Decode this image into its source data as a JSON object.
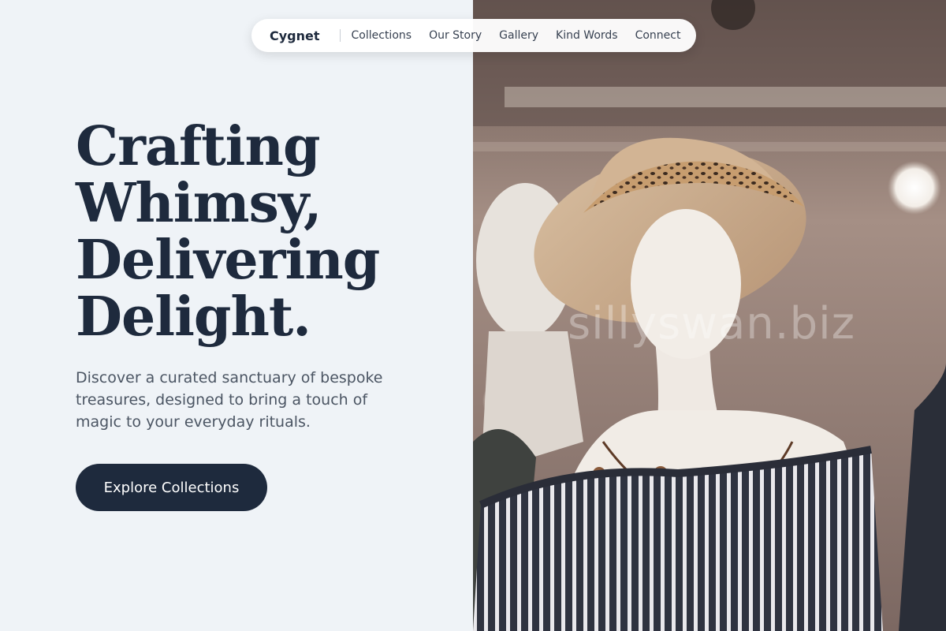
{
  "nav": {
    "brand": "Cygnet",
    "links": [
      {
        "label": "Collections"
      },
      {
        "label": "Our Story"
      },
      {
        "label": "Gallery"
      },
      {
        "label": "Kind Words"
      },
      {
        "label": "Connect"
      }
    ]
  },
  "hero": {
    "headline": [
      "Crafting",
      "Whimsy,",
      "Delivering",
      "Delight."
    ],
    "subtext": "Discover a curated sanctuary of bespoke treasures, designed to bring a touch of magic to your everyday rituals.",
    "cta_label": "Explore Collections"
  },
  "photo": {
    "subject": "mannequin wearing straw hat with leopard-print scarf, bead necklace and striped top",
    "watermark": "sillyswan.biz"
  },
  "colors": {
    "background": "#eff3f7",
    "navy": "#1e2a3d",
    "body_text": "#4b5563"
  }
}
